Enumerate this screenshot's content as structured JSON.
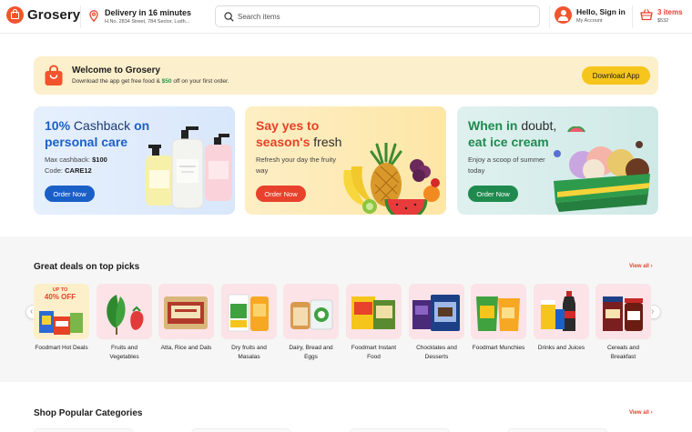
{
  "header": {
    "logo_text": "Grosery",
    "delivery_title": "Delivery in 16 minutes",
    "delivery_address": "H.No. 2834 Street, 784 Sector, Ludh...",
    "search_placeholder": "Search items",
    "account_title": "Hello, Sign in",
    "account_sub": "My Account",
    "cart_count": "3 items",
    "cart_total": "$532"
  },
  "welcome": {
    "title": "Welcome to Grosery",
    "desc_pre": "Download the app get free food &",
    "desc_amount": "$50",
    "desc_post": "off on your first order.",
    "button": "Download App"
  },
  "promos": [
    {
      "title_a": "10%",
      "title_b": "Cashback",
      "title_c": "on",
      "title_d": "personal care",
      "line1_label": "Max cashback:",
      "line1_value": "$100",
      "line2_label": "Code:",
      "line2_value": "CARE12",
      "button": "Order Now"
    },
    {
      "title_a": "Say yes to",
      "title_b": "season's",
      "title_c": "fresh",
      "text": "Refresh your day the fruity way",
      "button": "Order Now"
    },
    {
      "title_a": "When in",
      "title_b": "doubt,",
      "title_c": "eat ice cream",
      "text": "Enjoy a scoop of summer today",
      "button": "Order Now"
    }
  ],
  "deals": {
    "title": "Great deals on top picks",
    "view_all": "View all ›",
    "badge_line1": "UP TO",
    "badge_line2": "40% OFF",
    "items": [
      {
        "label": "Foodmart Hot Deals"
      },
      {
        "label": "Fruits and Vegetables"
      },
      {
        "label": "Atta, Rice and Dals"
      },
      {
        "label": "Dry fruits and Masalas"
      },
      {
        "label": "Dairy, Bread and Eggs"
      },
      {
        "label": "Foodmart Instant Food"
      },
      {
        "label": "Chocklates and Desserts"
      },
      {
        "label": "Foodmart Munchies"
      },
      {
        "label": "Drinks and Juices"
      },
      {
        "label": "Cereals and Breakfast"
      }
    ]
  },
  "popular": {
    "title": "Shop Popular Categories",
    "view_all": "View all ›"
  },
  "colors": {
    "brand": "#e8412c",
    "accent_yellow": "#f6c51c",
    "blue": "#1a5fc7",
    "green": "#1e8a4e"
  }
}
